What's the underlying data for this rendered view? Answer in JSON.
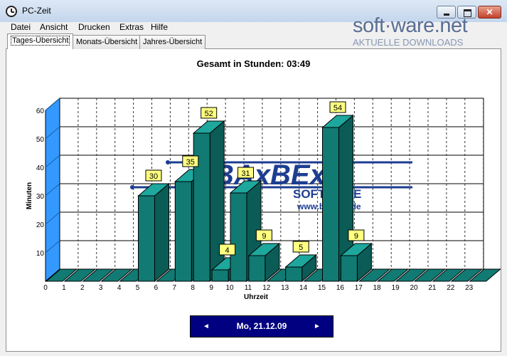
{
  "window": {
    "title": "PC-Zeit"
  },
  "menu": [
    "Datei",
    "Ansicht",
    "Drucken",
    "Extras",
    "Hilfe"
  ],
  "logo": {
    "main": "soft·ware.net",
    "sub": "AKTUELLE DOWNLOADS"
  },
  "tabs": [
    "Tages-Übersicht",
    "Monats-Übersicht",
    "Jahres-Übersicht"
  ],
  "summary": {
    "total": "Gesamt in Stunden: 03:49"
  },
  "watermark": {
    "name": "BAxBEx",
    "software": "SOFTWARE",
    "url": "www.baxbex.de"
  },
  "colors": {
    "bar": "#117a73",
    "bar_top": "#1ea79d",
    "bar_side": "#0b5b56",
    "label_bg": "#ffff80",
    "nav_bg": "#000080",
    "axis_wall": "#3399ff"
  },
  "chart_data": {
    "type": "bar",
    "xlabel": "Uhrzeit",
    "ylabel": "Minuten",
    "categories": [
      "0",
      "1",
      "2",
      "3",
      "4",
      "5",
      "6",
      "7",
      "8",
      "9",
      "10",
      "11",
      "12",
      "13",
      "14",
      "15",
      "16",
      "17",
      "18",
      "19",
      "20",
      "21",
      "22",
      "23"
    ],
    "values": [
      0,
      0,
      0,
      0,
      0,
      30,
      0,
      35,
      52,
      4,
      31,
      9,
      0,
      5,
      0,
      54,
      9,
      0,
      0,
      0,
      0,
      0,
      0,
      0
    ],
    "data_labels": [
      "30",
      "35",
      "52",
      "4",
      "31",
      "9",
      "5",
      "54",
      "9"
    ],
    "y_ticks": [
      "10",
      "20",
      "30",
      "40",
      "50",
      "60"
    ],
    "ylim": [
      0,
      60
    ],
    "grid": true
  },
  "navigation": {
    "prev": "◄",
    "next": "►",
    "date": "Mo, 21.12.09"
  }
}
